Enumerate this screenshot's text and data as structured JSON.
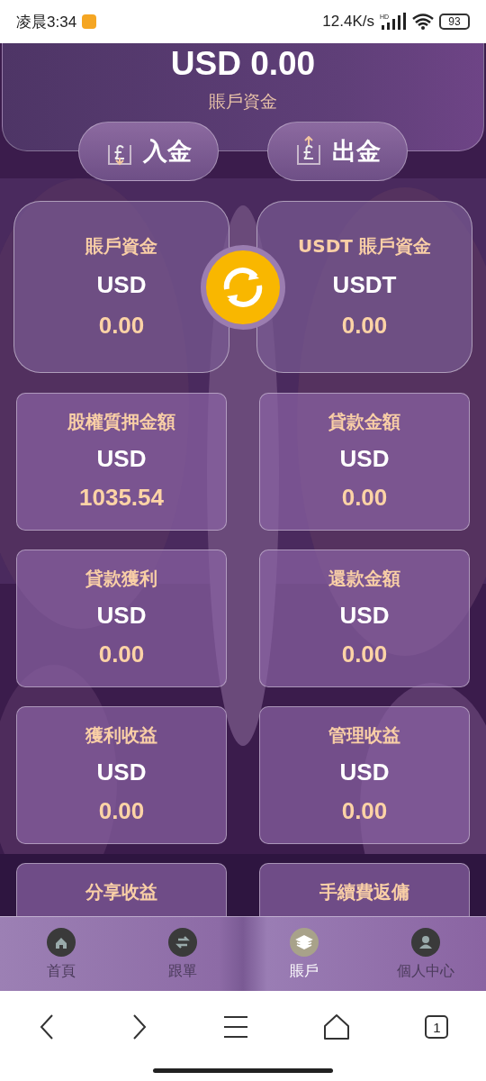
{
  "status_bar": {
    "time": "凌晨3:34",
    "speed": "12.4K/s",
    "network": "HD",
    "battery": "93"
  },
  "balance": {
    "total": "USD 0.00",
    "label": "賬戶資金"
  },
  "actions": [
    {
      "label": "入金",
      "kind": "deposit"
    },
    {
      "label": "出金",
      "kind": "withdraw"
    }
  ],
  "wallets": [
    {
      "title": "賬戶資金",
      "currency": "USD",
      "amount": "0.00"
    },
    {
      "title": "USDT 賬戶資金",
      "currency": "USDT",
      "amount": "0.00"
    }
  ],
  "accounts": [
    {
      "title": "股權質押金額",
      "currency": "USD",
      "amount": "1035.54"
    },
    {
      "title": "貸款金額",
      "currency": "USD",
      "amount": "0.00"
    },
    {
      "title": "貸款獲利",
      "currency": "USD",
      "amount": "0.00"
    },
    {
      "title": "還款金額",
      "currency": "USD",
      "amount": "0.00"
    },
    {
      "title": "獲利收益",
      "currency": "USD",
      "amount": "0.00"
    },
    {
      "title": "管理收益",
      "currency": "USD",
      "amount": "0.00"
    },
    {
      "title": "分享收益"
    },
    {
      "title": "手續費返傭"
    }
  ],
  "tab_bar": [
    {
      "label": "首頁",
      "kind": "home",
      "selected": false
    },
    {
      "label": "跟單",
      "kind": "swap",
      "selected": false
    },
    {
      "label": "賬戶",
      "kind": "layers",
      "selected": true
    },
    {
      "label": "個人中心",
      "kind": "person",
      "selected": false
    }
  ],
  "browser_bar": {
    "tab_count": "1"
  }
}
